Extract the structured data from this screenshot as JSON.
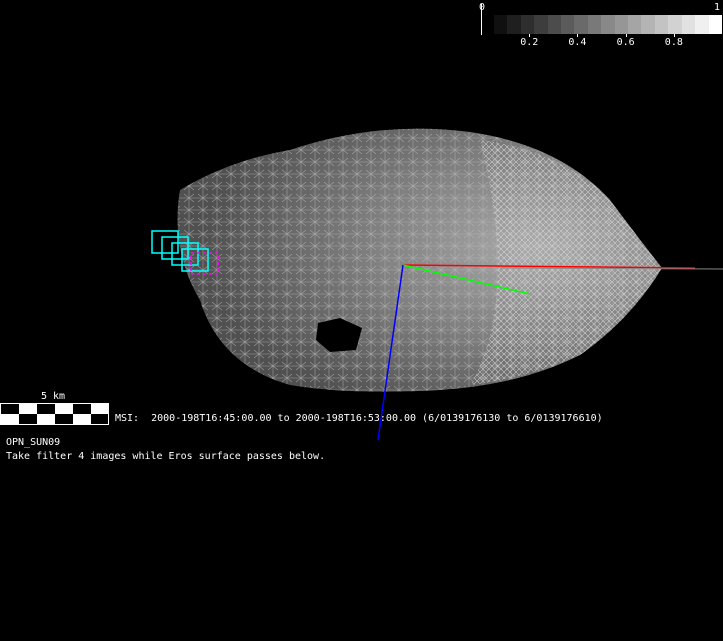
{
  "colorbar": {
    "min_label": "0",
    "max_label": "1",
    "ticks": [
      "0.2",
      "0.4",
      "0.6",
      "0.8"
    ],
    "tick_values": [
      0.2,
      0.4,
      0.6,
      0.8
    ],
    "segments": 17
  },
  "scale_bar": {
    "label": "5 km"
  },
  "msi_line": "MSI:  2000-198T16:45:00.00 to 2000-198T16:53:00.00 (6/0139176130 to 6/0139176610)",
  "observation": {
    "name": "OPN_SUN09",
    "description": "Take filter 4 images while Eros surface passes below."
  },
  "colors": {
    "x_axis": "#ff0000",
    "y_axis": "#00ff00",
    "z_axis": "#0000ff",
    "footprint": "#00ffff",
    "current_footprint": "#ff00ff"
  }
}
